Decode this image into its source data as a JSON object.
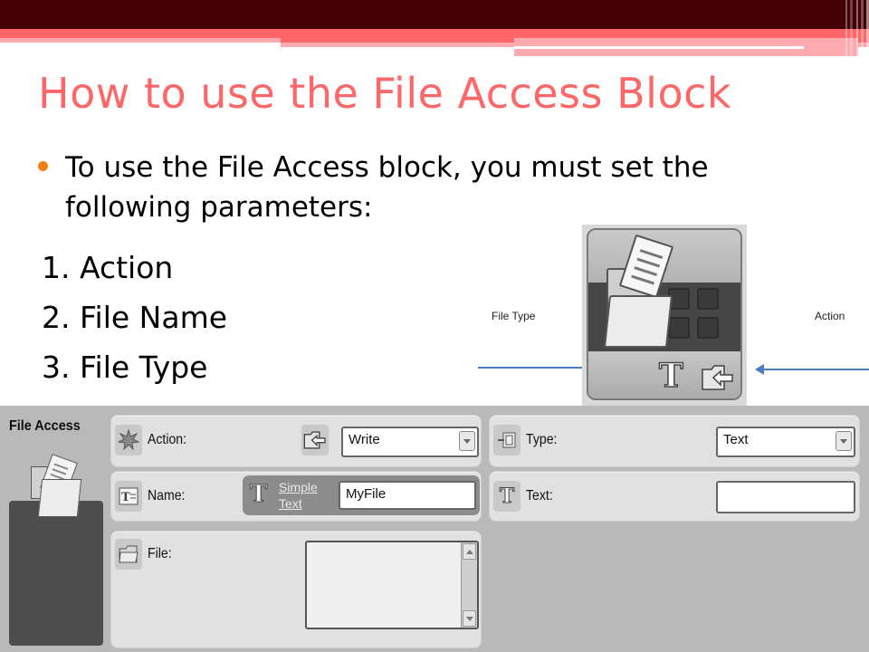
{
  "slide": {
    "title": "How to use the File Access Block",
    "bullet": "To use the File Access block, you must set the following parameters:",
    "numbered": [
      "1. Action",
      "2. File Name",
      "3. File Type"
    ],
    "colors": {
      "title": "#fe6668",
      "bullet_dot": "#f47e0f",
      "header_dark": "#420005",
      "header_accent": "#fe6668",
      "arrow": "#4a7bbf"
    }
  },
  "annotations": {
    "file_type_label": "File Type",
    "action_label": "Action"
  },
  "block_icon": {
    "icons": [
      "folder-document-icon",
      "text-T-icon",
      "folder-arrow-icon"
    ]
  },
  "config_panel": {
    "title": "File Access",
    "action": {
      "label": "Action:",
      "value": "Write"
    },
    "name": {
      "label": "Name:",
      "source_link": [
        "Simple",
        "Text"
      ],
      "value": "MyFile"
    },
    "file": {
      "label": "File:",
      "value": ""
    },
    "type": {
      "label": "Type:",
      "value": "Text"
    },
    "text": {
      "label": "Text:",
      "value": ""
    }
  }
}
